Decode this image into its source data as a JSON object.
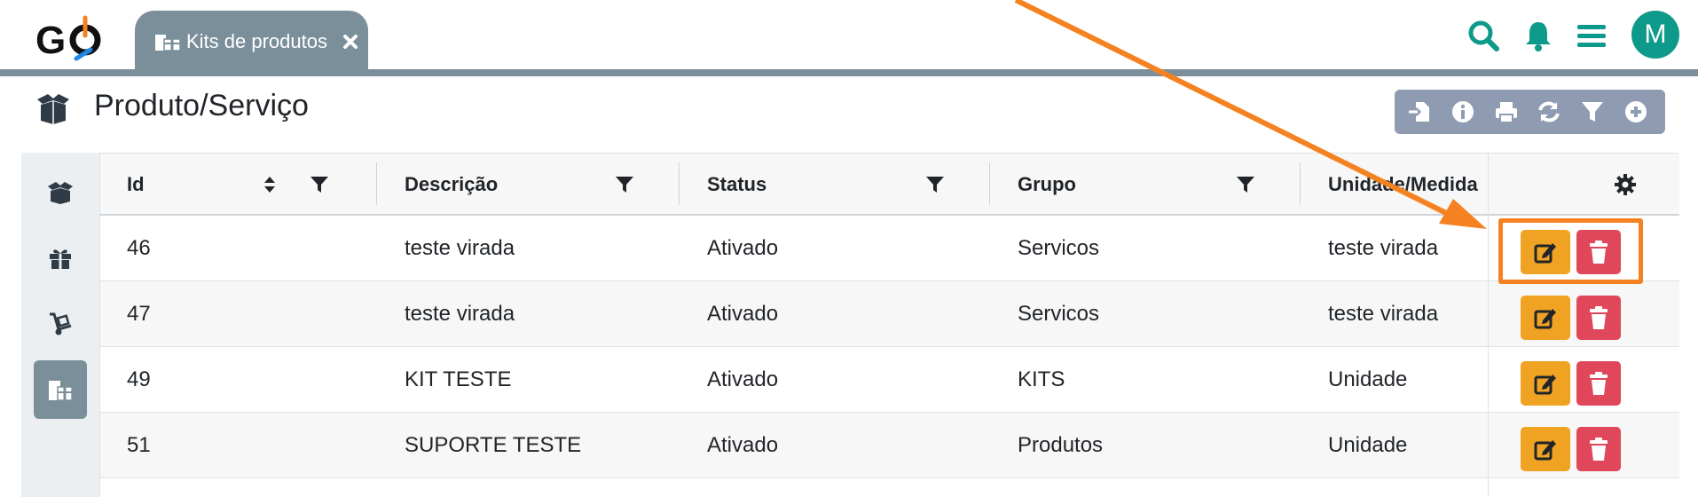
{
  "header": {
    "logo_text": "GO",
    "tab": {
      "label": "Kits de produtos",
      "icon": "gifts-icon",
      "close_icon": "close-icon"
    },
    "icons": [
      "search-icon",
      "bell-icon",
      "menu-icon"
    ],
    "avatar_initial": "M",
    "accent_color": "#0e9a8a",
    "bar_color": "#7b8f9a"
  },
  "page": {
    "title": "Produto/Serviço",
    "title_icon": "box-open-icon"
  },
  "toolbar": {
    "buttons": [
      "import-icon",
      "info-icon",
      "print-icon",
      "refresh-icon",
      "filter-icon",
      "add-icon"
    ]
  },
  "sidebar": {
    "items": [
      {
        "icon": "box-open-icon",
        "active": false
      },
      {
        "icon": "gift-icon",
        "active": false
      },
      {
        "icon": "dolly-icon",
        "active": false
      },
      {
        "icon": "gifts-icon",
        "active": true
      }
    ]
  },
  "table": {
    "columns": [
      "Id",
      "Descrição",
      "Status",
      "Grupo",
      "Unidade/Medida"
    ],
    "actions_header_icon": "gear-icon",
    "rows": [
      {
        "id": "46",
        "descricao": "teste virada",
        "status": "Ativado",
        "grupo": "Servicos",
        "unidade": "teste virada"
      },
      {
        "id": "47",
        "descricao": "teste virada",
        "status": "Ativado",
        "grupo": "Servicos",
        "unidade": "teste virada"
      },
      {
        "id": "49",
        "descricao": "KIT TESTE",
        "status": "Ativado",
        "grupo": "KITS",
        "unidade": "Unidade"
      },
      {
        "id": "51",
        "descricao": "SUPORTE TESTE",
        "status": "Ativado",
        "grupo": "Produtos",
        "unidade": "Unidade"
      }
    ],
    "edit_color": "#f0a223",
    "delete_color": "#e0475b"
  },
  "annotation": {
    "color": "#f58220"
  }
}
